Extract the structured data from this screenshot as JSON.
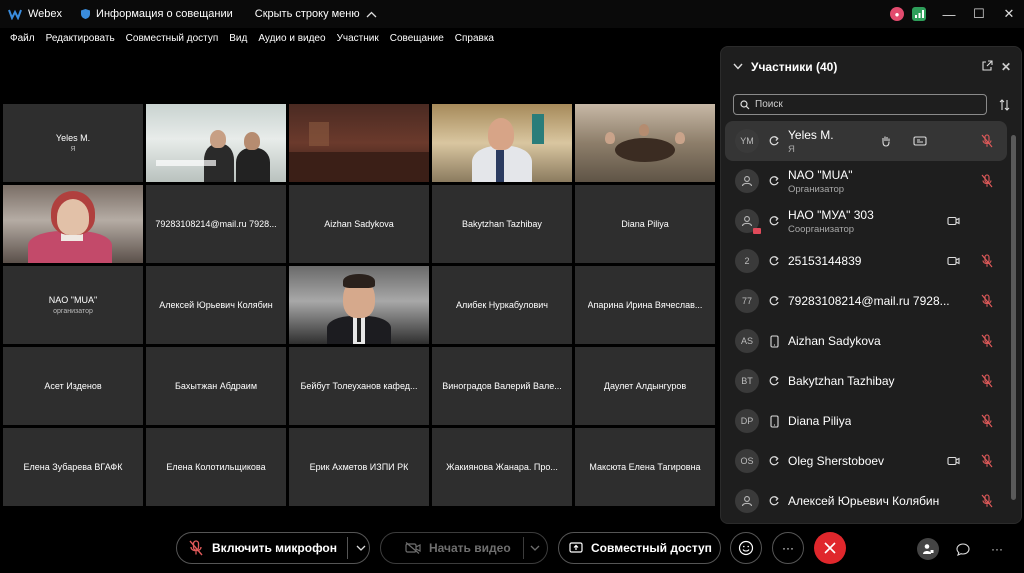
{
  "titlebar": {
    "app_name": "Webex",
    "meeting_info": "Информация о совещании",
    "hide_bar": "Скрыть строку меню"
  },
  "menu": [
    "Файл",
    "Редактировать",
    "Совместный доступ",
    "Вид",
    "Аудио и видео",
    "Участник",
    "Совещание",
    "Справка"
  ],
  "grid": [
    {
      "name": "Yeles M.",
      "sub": "Я",
      "video": false
    },
    {
      "name": "",
      "sub": "",
      "video": true,
      "scene": "room1"
    },
    {
      "name": "",
      "sub": "",
      "video": true,
      "scene": "room2"
    },
    {
      "name": "",
      "sub": "",
      "video": true,
      "scene": "room3"
    },
    {
      "name": "",
      "sub": "",
      "video": true,
      "scene": "room4"
    },
    {
      "name": "",
      "sub": "",
      "video": true,
      "scene": "room5"
    },
    {
      "name": "79283108214@mail.ru 7928...",
      "sub": "",
      "video": false
    },
    {
      "name": "Aizhan Sadykova",
      "sub": "",
      "video": false
    },
    {
      "name": "Bakytzhan Tazhibay",
      "sub": "",
      "video": false
    },
    {
      "name": "Diana Piliya",
      "sub": "",
      "video": false
    },
    {
      "name": "NAO \"MUA\"",
      "sub": "организатор",
      "video": false
    },
    {
      "name": "Алексей Юрьевич Колябин",
      "sub": "",
      "video": false
    },
    {
      "name": "",
      "sub": "",
      "video": true,
      "scene": "room6"
    },
    {
      "name": "Алибек Нуркабулович",
      "sub": "",
      "video": false
    },
    {
      "name": "Апарина Ирина Вячеслав...",
      "sub": "",
      "video": false
    },
    {
      "name": "Асет Изденов",
      "sub": "",
      "video": false
    },
    {
      "name": "Бахытжан Абдраим",
      "sub": "",
      "video": false
    },
    {
      "name": "Бейбут Толеуханов кафед...",
      "sub": "",
      "video": false
    },
    {
      "name": "Виноградов Валерий Вале...",
      "sub": "",
      "video": false
    },
    {
      "name": "Даулет Алдынгуров",
      "sub": "",
      "video": false
    },
    {
      "name": "Елена Зубарева ВГАФК",
      "sub": "",
      "video": false
    },
    {
      "name": "Елена Колотильщикова",
      "sub": "",
      "video": false
    },
    {
      "name": "Ерик Ахметов ИЗПИ РК",
      "sub": "",
      "video": false
    },
    {
      "name": "Жакиянова Жанара. Про...",
      "sub": "",
      "video": false
    },
    {
      "name": "Максюта Елена Тагировна",
      "sub": "",
      "video": false
    }
  ],
  "panel": {
    "title": "Участники (40)",
    "search_placeholder": "Поиск",
    "participants": [
      {
        "initials": "YM",
        "name": "Yeles M.",
        "role": "Я",
        "device": "sync",
        "video": false,
        "active": true
      },
      {
        "initials": "",
        "name": "NAO \"MUA\"",
        "role": "Организатор",
        "device": "sync",
        "video": false,
        "active": false
      },
      {
        "initials": "",
        "name": "НАО \"МУА\" 303",
        "role": "Соорганизатор",
        "device": "sync",
        "video": true,
        "active": false
      },
      {
        "initials": "2",
        "name": "25153144839",
        "role": "",
        "device": "sync",
        "video": true,
        "active": false
      },
      {
        "initials": "77",
        "name": "79283108214@mail.ru 7928...",
        "role": "",
        "device": "sync",
        "video": false,
        "active": false
      },
      {
        "initials": "AS",
        "name": "Aizhan Sadykova",
        "role": "",
        "device": "phone",
        "video": false,
        "active": false
      },
      {
        "initials": "BT",
        "name": "Bakytzhan Tazhibay",
        "role": "",
        "device": "sync",
        "video": false,
        "active": false
      },
      {
        "initials": "DP",
        "name": "Diana Piliya",
        "role": "",
        "device": "phone",
        "video": false,
        "active": false
      },
      {
        "initials": "OS",
        "name": "Oleg Sherstoboev",
        "role": "",
        "device": "sync",
        "video": true,
        "active": false
      },
      {
        "initials": "",
        "name": "Алексей Юрьевич Колябин",
        "role": "",
        "device": "sync",
        "video": false,
        "active": false
      }
    ]
  },
  "bottom": {
    "mic_label": "Включить микрофон",
    "video_label": "Начать видео",
    "share_label": "Совместный доступ"
  },
  "colors": {
    "end_call": "#e0272c",
    "muted_icon": "#e05a5a",
    "tile_bg": "#2e2e2e",
    "panel_bg": "#1e1e1e"
  }
}
